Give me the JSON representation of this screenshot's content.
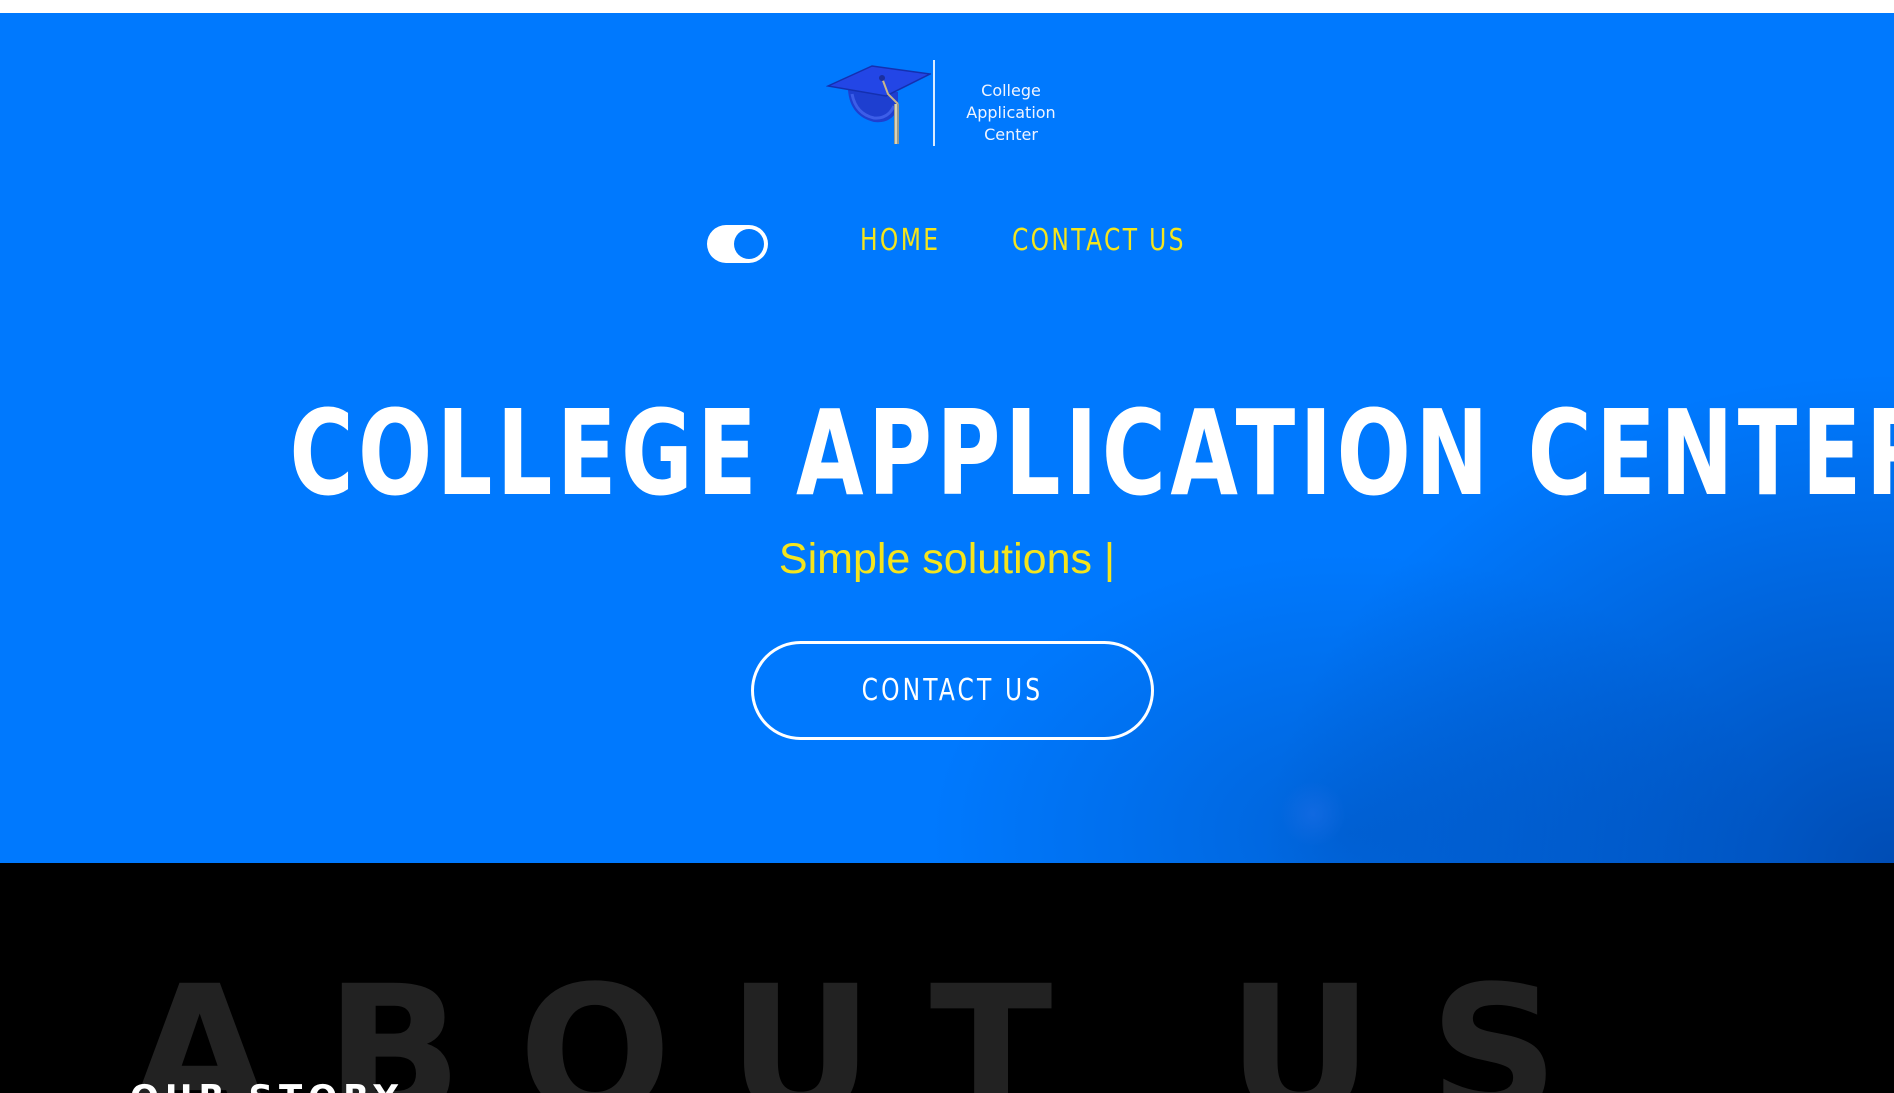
{
  "header": {
    "logo_text_line1": "College Application",
    "logo_text_line2": "Center",
    "nav": {
      "home_label": "HOME",
      "contact_label": "CONTACT US"
    },
    "theme_toggle": {
      "state": "on"
    }
  },
  "hero": {
    "title": "COLLEGE APPLICATION CENTER",
    "subtitle": "Simple solutions |",
    "cta_label": "CONTACT US"
  },
  "about": {
    "background_heading": "ABOUT US",
    "section_label": "OUR STORY"
  },
  "colors": {
    "hero_blue": "#0079fe",
    "accent_yellow": "#f5e51c",
    "white": "#ffffff",
    "dark_bg": "#000000",
    "about_watermark": "#222222"
  },
  "icons": {
    "logo": "graduation-cap-icon"
  }
}
